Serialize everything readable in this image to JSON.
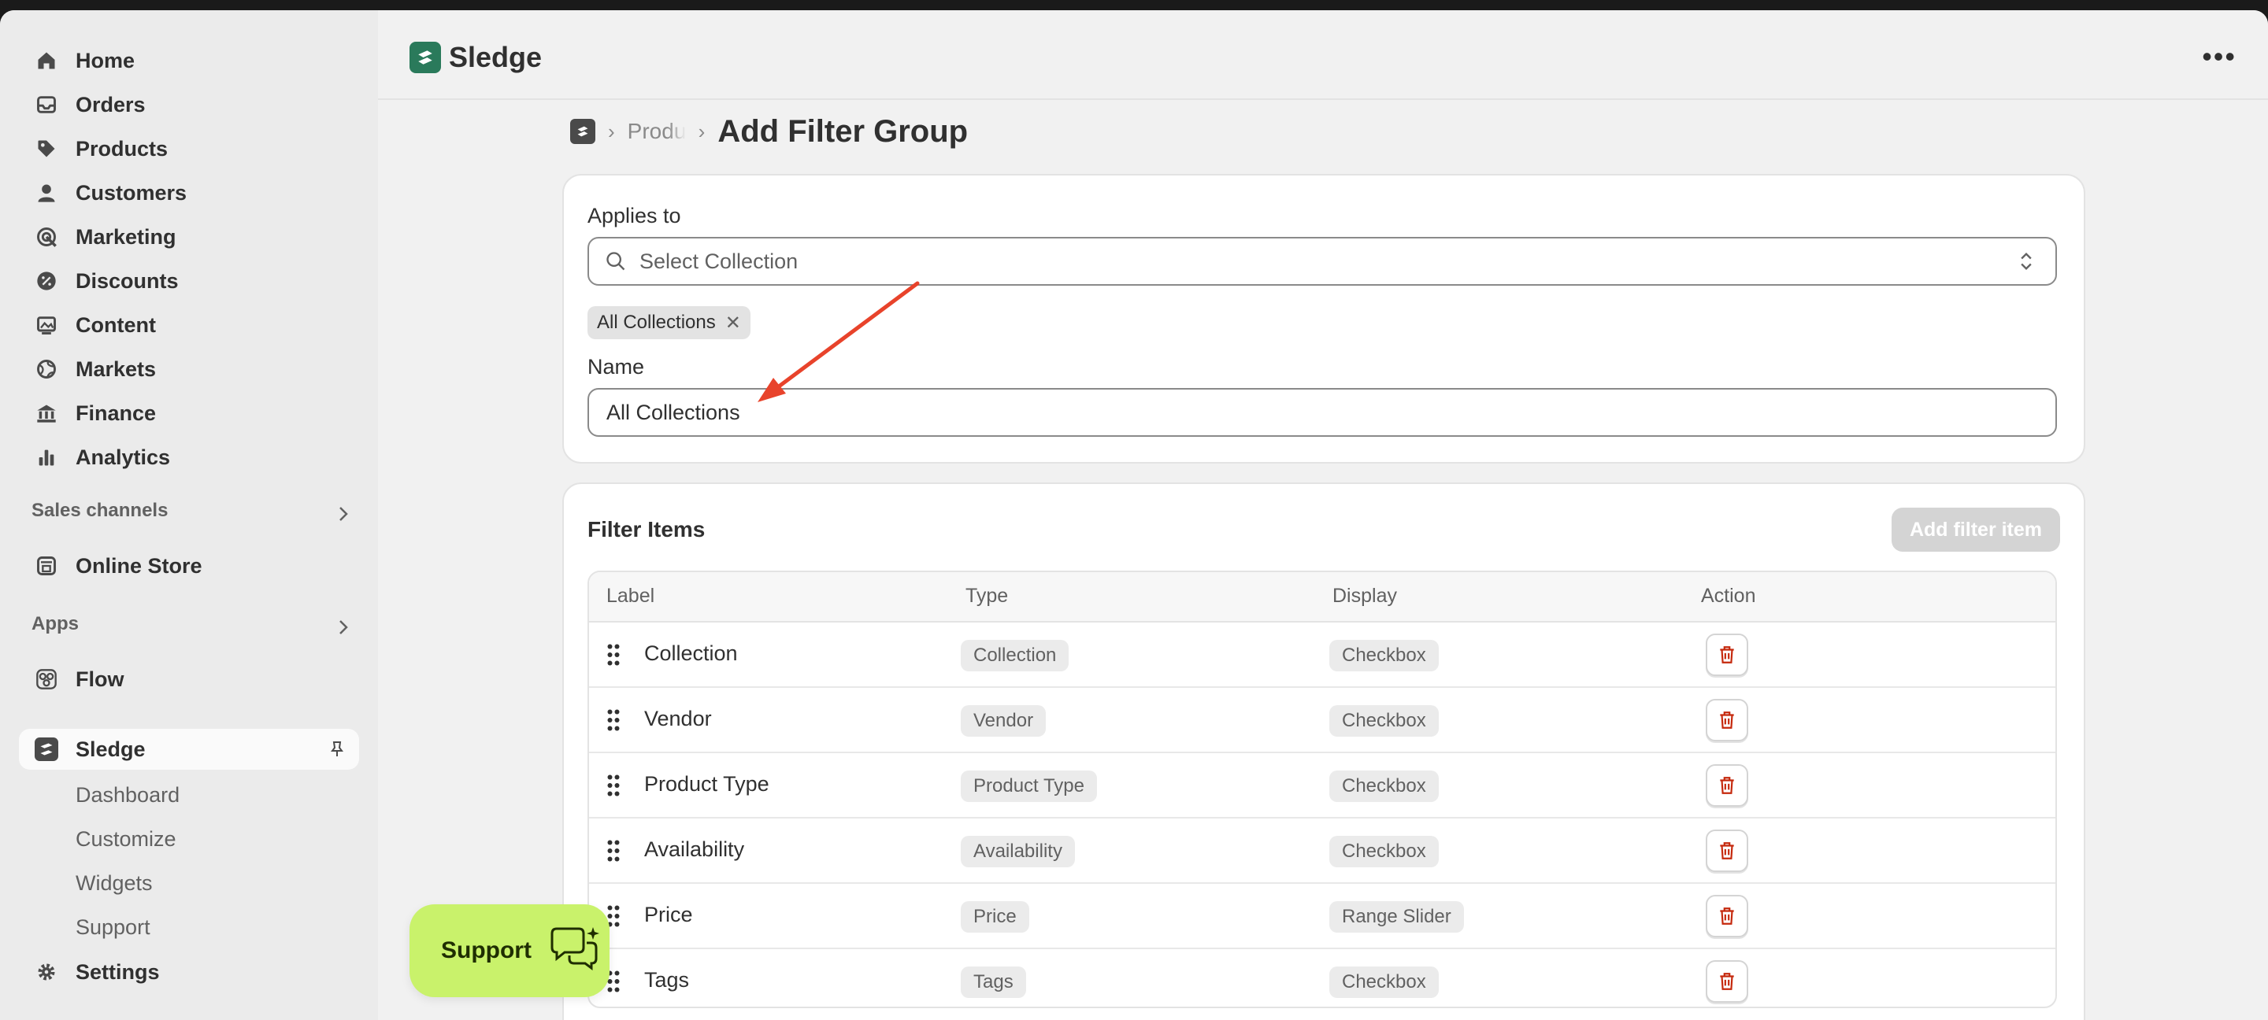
{
  "sidebar": {
    "items": [
      {
        "label": "Home",
        "icon": "home-icon"
      },
      {
        "label": "Orders",
        "icon": "inbox-icon"
      },
      {
        "label": "Products",
        "icon": "tag-icon"
      },
      {
        "label": "Customers",
        "icon": "person-icon"
      },
      {
        "label": "Marketing",
        "icon": "target-icon"
      },
      {
        "label": "Discounts",
        "icon": "discount-icon"
      },
      {
        "label": "Content",
        "icon": "image-icon"
      },
      {
        "label": "Markets",
        "icon": "globe-icon"
      },
      {
        "label": "Finance",
        "icon": "bank-icon"
      },
      {
        "label": "Analytics",
        "icon": "bar-chart-icon"
      }
    ],
    "sales_channels_label": "Sales channels",
    "online_store": "Online Store",
    "apps_label": "Apps",
    "flow": "Flow",
    "sledge": "Sledge",
    "sledge_sub": [
      "Dashboard",
      "Customize",
      "Widgets",
      "Support"
    ],
    "settings": "Settings"
  },
  "topbar": {
    "app_title": "Sledge",
    "more_icon": "more-horizontal-icon"
  },
  "breadcrumb": {
    "link": "Product Filters",
    "title": "Add Filter Group"
  },
  "applies_card": {
    "applies_label": "Applies to",
    "select_placeholder": "Select Collection",
    "chip": "All Collections",
    "name_label": "Name",
    "name_value": "All Collections"
  },
  "filter_card": {
    "title": "Filter Items",
    "add_button": "Add filter item",
    "headers": {
      "label": "Label",
      "type": "Type",
      "display": "Display",
      "action": "Action"
    },
    "rows": [
      {
        "label": "Collection",
        "type": "Collection",
        "display": "Checkbox"
      },
      {
        "label": "Vendor",
        "type": "Vendor",
        "display": "Checkbox"
      },
      {
        "label": "Product Type",
        "type": "Product Type",
        "display": "Checkbox"
      },
      {
        "label": "Availability",
        "type": "Availability",
        "display": "Checkbox"
      },
      {
        "label": "Price",
        "type": "Price",
        "display": "Range Slider"
      },
      {
        "label": "Tags",
        "type": "Tags",
        "display": "Checkbox"
      }
    ]
  },
  "support_button": "Support",
  "colors": {
    "accent": "#c9f26b",
    "danger": "#c5280c",
    "arrow": "#e8432b"
  }
}
